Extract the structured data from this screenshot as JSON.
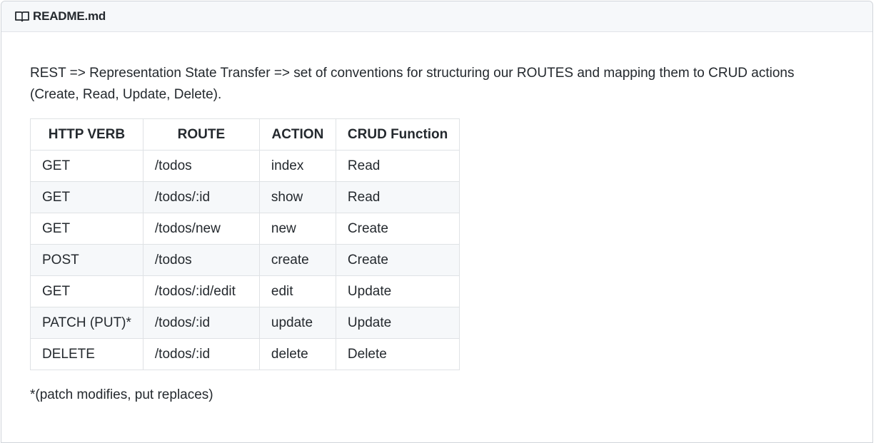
{
  "header": {
    "icon": "book-icon",
    "filename": "README.md"
  },
  "intro": {
    "text": "REST => Representation State Transfer => set of conventions for structuring our ROUTES and mapping them to CRUD actions (Create, Read, Update, Delete)."
  },
  "table": {
    "headers": [
      "HTTP VERB",
      "ROUTE",
      "ACTION",
      "CRUD Function"
    ],
    "rows": [
      [
        "GET",
        "/todos",
        "index",
        "Read"
      ],
      [
        "GET",
        "/todos/:id",
        "show",
        "Read"
      ],
      [
        "GET",
        "/todos/new",
        "new",
        "Create"
      ],
      [
        "POST",
        "/todos",
        "create",
        "Create"
      ],
      [
        "GET",
        "/todos/:id/edit",
        "edit",
        "Update"
      ],
      [
        "PATCH (PUT)*",
        "/todos/:id",
        "update",
        "Update"
      ],
      [
        "DELETE",
        "/todos/:id",
        "delete",
        "Delete"
      ]
    ]
  },
  "footnote": {
    "text": "*(patch modifies, put replaces)"
  },
  "colors": {
    "header_bg": "#f6f8fa",
    "border": "#dfe2e5",
    "text": "#24292e",
    "striped_row": "#f6f8fa"
  }
}
